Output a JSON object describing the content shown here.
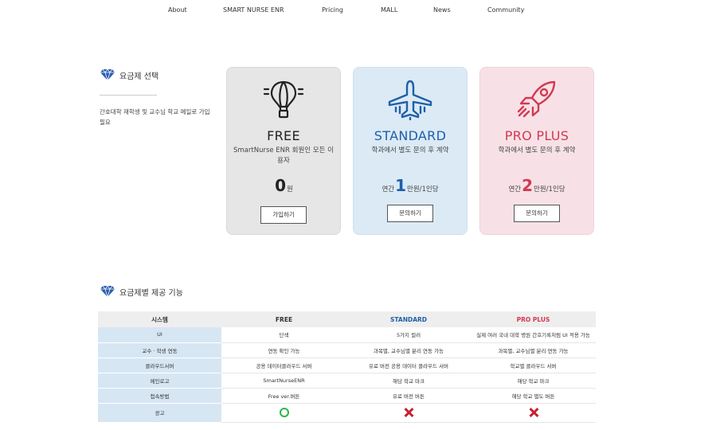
{
  "nav": {
    "items": [
      {
        "label": "About"
      },
      {
        "label": "SMART NURSE ENR"
      },
      {
        "label": "Pricing"
      },
      {
        "label": "MALL"
      },
      {
        "label": "News"
      },
      {
        "label": "Community"
      }
    ]
  },
  "plan_section": {
    "title": "요금제 선택",
    "description": "간호대학 재학생 및 교수님 학교 메일로 가입 필요",
    "icon": "diamond-icon"
  },
  "plans": [
    {
      "name": "FREE",
      "subtitle": "SmartNurse ENR 회원인 모든 이용자",
      "price_prefix": "",
      "price_number": "0",
      "price_suffix": "원",
      "button_label": "가입하기",
      "icon": "hot-air-balloon-icon",
      "color": "#222222",
      "background": "#e6e6e6"
    },
    {
      "name": "STANDARD",
      "subtitle": "학과에서 별도 문의 후 계약",
      "price_prefix": "연간",
      "price_number": "1",
      "price_suffix": "만원/1인당",
      "button_label": "문의하기",
      "icon": "airplane-icon",
      "color": "#1f5fa8",
      "background": "#dbeaf5"
    },
    {
      "name": "PRO PLUS",
      "subtitle": "학과에서 별도 문의 후 계약",
      "price_prefix": "연간",
      "price_number": "2",
      "price_suffix": "만원/1인당",
      "button_label": "문의하기",
      "icon": "rocket-icon",
      "color": "#d23a52",
      "background": "#f7e1e6"
    }
  ],
  "features_section": {
    "title": "요금제별 제공 기능",
    "icon": "diamond-icon"
  },
  "features_table": {
    "headers": [
      "시스템",
      "FREE",
      "STANDARD",
      "PRO PLUS"
    ],
    "rows": [
      [
        "UI",
        "단색",
        "5가지 컬러",
        "실제 여러 국내 대학 병원 간호기록처럼 UI 적용 가능"
      ],
      [
        "교수 · 학생 연동",
        "연동 확인 가능",
        "과목별, 교수님별 분리 연동 가능",
        "과목별, 교수님별 분리 연동 가능"
      ],
      [
        "클라우드서버",
        "공용 데이터클라우드 서버",
        "유료 버전 공용 데이터 클라우드 서버",
        "학교별 클라우드 서버"
      ],
      [
        "메인로고",
        "SmartNurseENR",
        "해당 학교 마크",
        "해당 학교 마크"
      ],
      [
        "접속방법",
        "Free ver.버튼",
        "유료 버전 버튼",
        "해당 학교 별도 버튼"
      ]
    ],
    "ads_row": {
      "label": "광고",
      "values": [
        "o",
        "x",
        "x"
      ]
    },
    "colors": {
      "o": "#2db34a",
      "x": "#c8202f"
    }
  }
}
